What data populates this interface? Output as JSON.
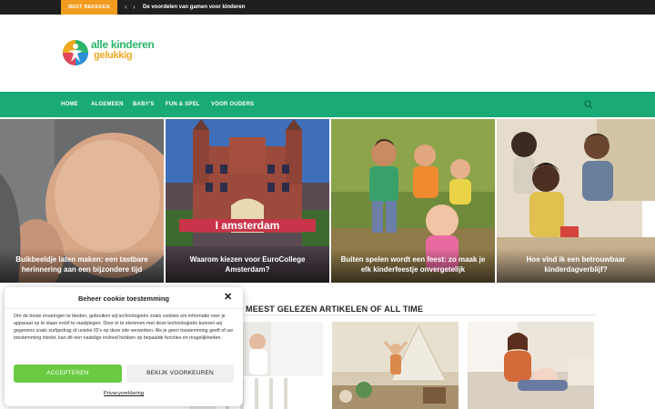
{
  "topbar": {
    "badge": "BEST BEKEKEN",
    "prev_icon": "chevron-left-icon",
    "next_icon": "chevron-right-icon",
    "headline": "De voordelen van gamen voor kinderen"
  },
  "logo": {
    "line1": "alle kinderen",
    "line2": "gelukkig"
  },
  "nav": {
    "items": [
      "HOME",
      "ALGEMEEN",
      "BABY'S",
      "FUN & SPEL",
      "VOOR OUDERS"
    ],
    "search_icon": "search-icon"
  },
  "featured": [
    {
      "title": "Buikbeeldje laten maken: een tastbare herinnering aan een bijzondere tijd"
    },
    {
      "title": "Waarom kiezen voor EuroCollege Amsterdam?",
      "image_text": "I amsterdam"
    },
    {
      "title": "Buiten spelen wordt een feest: zo maak je elk kinderfeestje onvergetelijk"
    },
    {
      "title": "Hoe vind ik een betrouwbaar kinderdagverblijf?"
    }
  ],
  "section": {
    "title": "MEEST GELEZEN ARTIKELEN OF ALL TIME"
  },
  "cookie": {
    "title": "Beheer cookie toestemming",
    "close_icon": "close-icon",
    "body": "Om de beste ervaringen te bieden, gebruiken wij technologieën zoals cookies om informatie over je apparaat op te slaan en/of te raadplegen. Door in te stemmen met deze technologieën kunnen wij gegevens zoals surfgedrag of unieke ID's op deze site verwerken. Als je geen toestemming geeft of uw toestemming intrekt, kan dit een nadelige invloed hebben op bepaalde functies en mogelijkheden.",
    "accept_label": "ACCEPTEREN",
    "prefs_label": "BEKIJK VOORKEUREN",
    "privacy_link": "Privacyverklaring"
  },
  "colors": {
    "topbar_bg": "#1f1f1f",
    "badge_bg": "#f29c1f",
    "nav_bg": "#1aaa76",
    "accept_bg": "#6acb42",
    "logo_green": "#2bb56a",
    "logo_orange": "#f0a91c"
  }
}
